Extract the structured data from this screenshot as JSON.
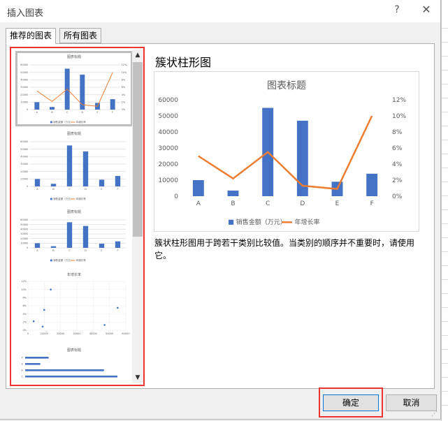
{
  "dialog": {
    "title": "插入图表",
    "help_label": "?",
    "close_label": "✕",
    "tabs": [
      {
        "label": "推荐的图表",
        "active": true
      },
      {
        "label": "所有图表",
        "active": false
      }
    ],
    "ok_label": "确定",
    "cancel_label": "取消"
  },
  "thumbnails": [
    {
      "title": "图表标题",
      "kind": "combo",
      "selected": true
    },
    {
      "title": "图表标题",
      "kind": "bar",
      "selected": false
    },
    {
      "title": "图表标题",
      "kind": "bar",
      "selected": false
    },
    {
      "title": "年增长率",
      "kind": "scatter",
      "selected": false
    },
    {
      "title": "图表标题",
      "kind": "hbar",
      "selected": false
    }
  ],
  "preview": {
    "heading": "簇状柱形图",
    "description": "簇状柱形图用于跨若干类别比较值。当类别的顺序并不重要时，请使用它。"
  },
  "colors": {
    "bar": "#4472c4",
    "line": "#ed7d31",
    "highlight": "#ee3333"
  },
  "chart_data": {
    "type": "bar",
    "title": "图表标题",
    "categories": [
      "A",
      "B",
      "C",
      "D",
      "E",
      "F"
    ],
    "series": [
      {
        "name": "销售金额（万元）",
        "type": "bar",
        "axis": "left",
        "values": [
          10000,
          3500,
          55000,
          47000,
          9000,
          14000
        ]
      },
      {
        "name": "年增长率",
        "type": "line",
        "axis": "right",
        "values": [
          0.05,
          0.022,
          0.055,
          0.013,
          0.009,
          0.1
        ]
      }
    ],
    "y_ticks": [
      "0",
      "10000",
      "20000",
      "30000",
      "40000",
      "50000",
      "60000"
    ],
    "y2_ticks": [
      "0%",
      "2%",
      "4%",
      "6%",
      "8%",
      "10%",
      "12%"
    ],
    "ylim": [
      0,
      60000
    ],
    "y2lim": [
      0,
      0.12
    ],
    "grid": true,
    "legend": "bottom"
  },
  "scatter_thumb": {
    "y_ticks": [
      "0%",
      "2%",
      "4%",
      "6%",
      "8%",
      "10%",
      "12%"
    ],
    "x_ticks": [
      "0",
      "10000",
      "20000",
      "30000",
      "40000",
      "50000",
      "60000"
    ]
  }
}
